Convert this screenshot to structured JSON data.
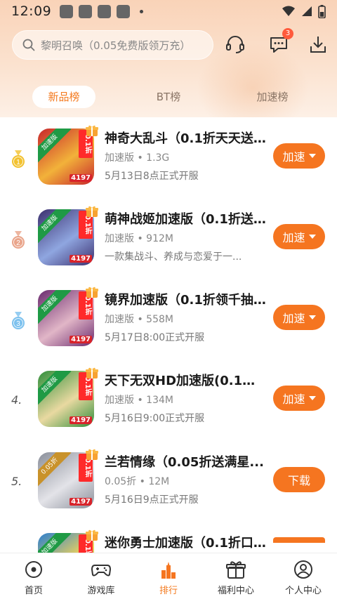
{
  "status_bar": {
    "time": "12:09"
  },
  "search": {
    "placeholder": "黎明召唤（0.05免费版领万充）"
  },
  "header": {
    "message_badge": "3"
  },
  "tabs": [
    {
      "label": "新品榜",
      "active": true
    },
    {
      "label": "BT榜",
      "active": false
    },
    {
      "label": "加速榜",
      "active": false
    }
  ],
  "games": [
    {
      "rank": "1",
      "title": "神奇大乱斗（0.1折天天送...",
      "meta": "加速版 • 1.3G",
      "desc": "5月13日8点正式开服",
      "action": "加速",
      "has_menu": true,
      "icon_colors": [
        "#c7262c",
        "#f2b23a"
      ]
    },
    {
      "rank": "2",
      "title": "萌神战姬加速版（0.1折送...",
      "meta": "加速版 • 912M",
      "desc": "一款集战斗、养成与恋爱于一...",
      "action": "加速",
      "has_menu": true,
      "icon_colors": [
        "#3b2f6e",
        "#8fa6e0"
      ]
    },
    {
      "rank": "3",
      "title": "镜界加速版（0.1折领千抽...",
      "meta": "加速版 • 558M",
      "desc": "5月17日8:00正式开服",
      "action": "加速",
      "has_menu": true,
      "icon_colors": [
        "#6a2a6e",
        "#e1b6c7"
      ]
    },
    {
      "rank": "4.",
      "title": "天下无双HD加速版(0.1折...",
      "meta": "加速版 • 134M",
      "desc": "5月16日9:00正式开服",
      "action": "加速",
      "has_menu": true,
      "icon_colors": [
        "#2f8e3a",
        "#e9d9a1"
      ]
    },
    {
      "rank": "5.",
      "title": "兰若情缘（0.05折送满星...",
      "meta": "0.05折 • 12M",
      "desc": "5月16日9点正式开服",
      "action": "下载",
      "has_menu": false,
      "icon_colors": [
        "#8a8f9a",
        "#e3e3e8"
      ]
    },
    {
      "rank": "",
      "title": "迷你勇士加速版（0.1折口...",
      "meta": "",
      "desc": "",
      "action": "",
      "has_menu": false,
      "icon_colors": [
        "#2b7ed0",
        "#f0d45a"
      ]
    }
  ],
  "icon_text": {
    "tag_speed": "加速版",
    "tag_005": "0.05折",
    "disc": "0.1折",
    "code": "4197"
  },
  "bottom_nav": [
    {
      "label": "首页",
      "icon": "home-icon",
      "active": false
    },
    {
      "label": "游戏库",
      "icon": "gamepad-icon",
      "active": false
    },
    {
      "label": "排行",
      "icon": "ranking-icon",
      "active": true
    },
    {
      "label": "福利中心",
      "icon": "gift-icon",
      "active": false
    },
    {
      "label": "个人中心",
      "icon": "user-icon",
      "active": false
    }
  ],
  "colors": {
    "accent": "#f57520",
    "header_bg": "#f9d3b8",
    "medal_gold": "#f2c12e",
    "medal_silver": "#e9a48a",
    "medal_bronze": "#7cc1ee"
  }
}
